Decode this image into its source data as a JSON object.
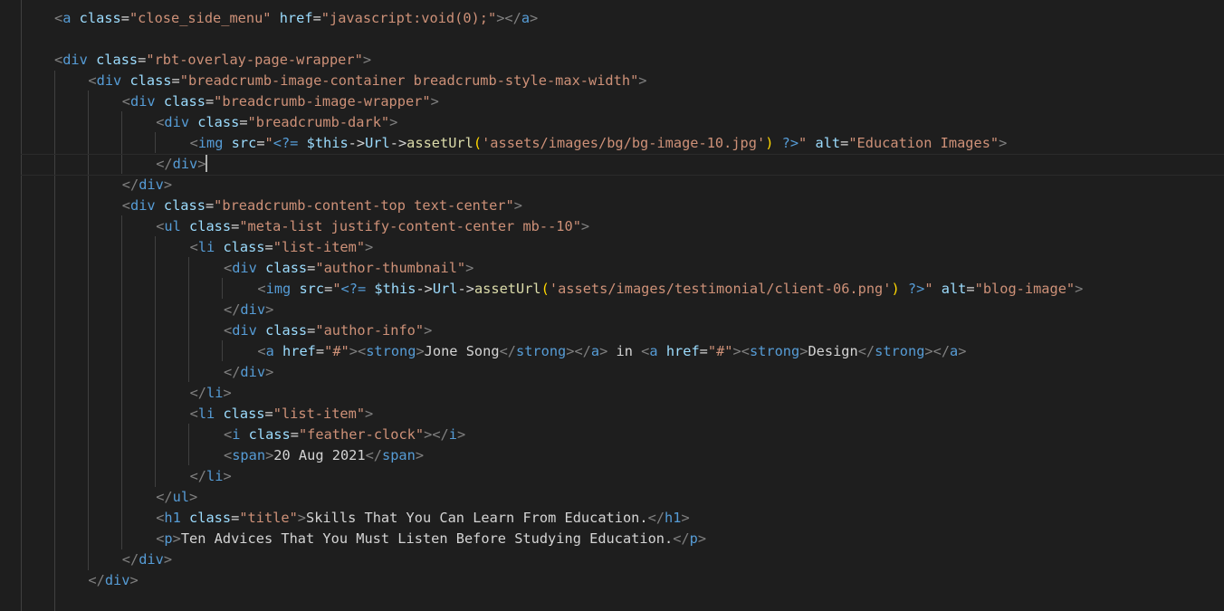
{
  "editor": {
    "language": "html",
    "theme_colors": {
      "background": "#1e1e1e",
      "tag": "#569cd6",
      "punctuation": "#808080",
      "attribute": "#9cdcfe",
      "string": "#ce9178",
      "text": "#d4d4d4",
      "function": "#dcdcaa",
      "brace": "#ffd700"
    },
    "cursor_line": 8,
    "lines": [
      {
        "indent": 0,
        "tokens": [
          [
            "punct",
            "<"
          ],
          [
            "tag",
            "a"
          ],
          [
            "text",
            " "
          ],
          [
            "attr",
            "class"
          ],
          [
            "text",
            "="
          ],
          [
            "str",
            "\"close_side_menu\""
          ],
          [
            "text",
            " "
          ],
          [
            "attr",
            "href"
          ],
          [
            "text",
            "="
          ],
          [
            "str",
            "\"javascript:void(0);\""
          ],
          [
            "punct",
            ">"
          ],
          [
            "punct",
            "</"
          ],
          [
            "tag",
            "a"
          ],
          [
            "punct",
            ">"
          ]
        ]
      },
      {
        "indent": 0,
        "tokens": []
      },
      {
        "indent": 0,
        "tokens": [
          [
            "punct",
            "<"
          ],
          [
            "tag",
            "div"
          ],
          [
            "text",
            " "
          ],
          [
            "attr",
            "class"
          ],
          [
            "text",
            "="
          ],
          [
            "str",
            "\"rbt-overlay-page-wrapper\""
          ],
          [
            "punct",
            ">"
          ]
        ]
      },
      {
        "indent": 1,
        "tokens": [
          [
            "punct",
            "<"
          ],
          [
            "tag",
            "div"
          ],
          [
            "text",
            " "
          ],
          [
            "attr",
            "class"
          ],
          [
            "text",
            "="
          ],
          [
            "str",
            "\"breadcrumb-image-container breadcrumb-style-max-width\""
          ],
          [
            "punct",
            ">"
          ]
        ]
      },
      {
        "indent": 2,
        "tokens": [
          [
            "punct",
            "<"
          ],
          [
            "tag",
            "div"
          ],
          [
            "text",
            " "
          ],
          [
            "attr",
            "class"
          ],
          [
            "text",
            "="
          ],
          [
            "str",
            "\"breadcrumb-image-wrapper\""
          ],
          [
            "punct",
            ">"
          ]
        ]
      },
      {
        "indent": 3,
        "tokens": [
          [
            "punct",
            "<"
          ],
          [
            "tag",
            "div"
          ],
          [
            "text",
            " "
          ],
          [
            "attr",
            "class"
          ],
          [
            "text",
            "="
          ],
          [
            "str",
            "\"breadcrumb-dark\""
          ],
          [
            "punct",
            ">"
          ]
        ]
      },
      {
        "indent": 4,
        "tokens": [
          [
            "punct",
            "<"
          ],
          [
            "tag",
            "img"
          ],
          [
            "text",
            " "
          ],
          [
            "attr",
            "src"
          ],
          [
            "text",
            "="
          ],
          [
            "str",
            "\""
          ],
          [
            "php",
            "<?="
          ],
          [
            "text",
            " "
          ],
          [
            "var",
            "$this"
          ],
          [
            "op",
            "->"
          ],
          [
            "var",
            "Url"
          ],
          [
            "op",
            "->"
          ],
          [
            "func",
            "assetUrl"
          ],
          [
            "brace",
            "("
          ],
          [
            "str",
            "'assets/images/bg/bg-image-10.jpg'"
          ],
          [
            "brace",
            ")"
          ],
          [
            "text",
            " "
          ],
          [
            "php",
            "?>"
          ],
          [
            "str",
            "\""
          ],
          [
            "text",
            " "
          ],
          [
            "attr",
            "alt"
          ],
          [
            "text",
            "="
          ],
          [
            "str",
            "\"Education Images\""
          ],
          [
            "punct",
            ">"
          ]
        ]
      },
      {
        "indent": 3,
        "tokens": [
          [
            "punct",
            "</"
          ],
          [
            "tag",
            "div"
          ],
          [
            "punct",
            ">"
          ]
        ],
        "cursor": true
      },
      {
        "indent": 2,
        "tokens": [
          [
            "punct",
            "</"
          ],
          [
            "tag",
            "div"
          ],
          [
            "punct",
            ">"
          ]
        ]
      },
      {
        "indent": 2,
        "tokens": [
          [
            "punct",
            "<"
          ],
          [
            "tag",
            "div"
          ],
          [
            "text",
            " "
          ],
          [
            "attr",
            "class"
          ],
          [
            "text",
            "="
          ],
          [
            "str",
            "\"breadcrumb-content-top text-center\""
          ],
          [
            "punct",
            ">"
          ]
        ]
      },
      {
        "indent": 3,
        "tokens": [
          [
            "punct",
            "<"
          ],
          [
            "tag",
            "ul"
          ],
          [
            "text",
            " "
          ],
          [
            "attr",
            "class"
          ],
          [
            "text",
            "="
          ],
          [
            "str",
            "\"meta-list justify-content-center mb--10\""
          ],
          [
            "punct",
            ">"
          ]
        ]
      },
      {
        "indent": 4,
        "tokens": [
          [
            "punct",
            "<"
          ],
          [
            "tag",
            "li"
          ],
          [
            "text",
            " "
          ],
          [
            "attr",
            "class"
          ],
          [
            "text",
            "="
          ],
          [
            "str",
            "\"list-item\""
          ],
          [
            "punct",
            ">"
          ]
        ]
      },
      {
        "indent": 5,
        "tokens": [
          [
            "punct",
            "<"
          ],
          [
            "tag",
            "div"
          ],
          [
            "text",
            " "
          ],
          [
            "attr",
            "class"
          ],
          [
            "text",
            "="
          ],
          [
            "str",
            "\"author-thumbnail\""
          ],
          [
            "punct",
            ">"
          ]
        ]
      },
      {
        "indent": 6,
        "tokens": [
          [
            "punct",
            "<"
          ],
          [
            "tag",
            "img"
          ],
          [
            "text",
            " "
          ],
          [
            "attr",
            "src"
          ],
          [
            "text",
            "="
          ],
          [
            "str",
            "\""
          ],
          [
            "php",
            "<?="
          ],
          [
            "text",
            " "
          ],
          [
            "var",
            "$this"
          ],
          [
            "op",
            "->"
          ],
          [
            "var",
            "Url"
          ],
          [
            "op",
            "->"
          ],
          [
            "func",
            "assetUrl"
          ],
          [
            "brace",
            "("
          ],
          [
            "str",
            "'assets/images/testimonial/client-06.png'"
          ],
          [
            "brace",
            ")"
          ],
          [
            "text",
            " "
          ],
          [
            "php",
            "?>"
          ],
          [
            "str",
            "\""
          ],
          [
            "text",
            " "
          ],
          [
            "attr",
            "alt"
          ],
          [
            "text",
            "="
          ],
          [
            "str",
            "\"blog-image\""
          ],
          [
            "punct",
            ">"
          ]
        ]
      },
      {
        "indent": 5,
        "tokens": [
          [
            "punct",
            "</"
          ],
          [
            "tag",
            "div"
          ],
          [
            "punct",
            ">"
          ]
        ]
      },
      {
        "indent": 5,
        "tokens": [
          [
            "punct",
            "<"
          ],
          [
            "tag",
            "div"
          ],
          [
            "text",
            " "
          ],
          [
            "attr",
            "class"
          ],
          [
            "text",
            "="
          ],
          [
            "str",
            "\"author-info\""
          ],
          [
            "punct",
            ">"
          ]
        ]
      },
      {
        "indent": 6,
        "tokens": [
          [
            "punct",
            "<"
          ],
          [
            "tag",
            "a"
          ],
          [
            "text",
            " "
          ],
          [
            "attr",
            "href"
          ],
          [
            "text",
            "="
          ],
          [
            "str",
            "\"#\""
          ],
          [
            "punct",
            ">"
          ],
          [
            "punct",
            "<"
          ],
          [
            "tag",
            "strong"
          ],
          [
            "punct",
            ">"
          ],
          [
            "text",
            "Jone Song"
          ],
          [
            "punct",
            "</"
          ],
          [
            "tag",
            "strong"
          ],
          [
            "punct",
            ">"
          ],
          [
            "punct",
            "</"
          ],
          [
            "tag",
            "a"
          ],
          [
            "punct",
            ">"
          ],
          [
            "text",
            " in "
          ],
          [
            "punct",
            "<"
          ],
          [
            "tag",
            "a"
          ],
          [
            "text",
            " "
          ],
          [
            "attr",
            "href"
          ],
          [
            "text",
            "="
          ],
          [
            "str",
            "\"#\""
          ],
          [
            "punct",
            ">"
          ],
          [
            "punct",
            "<"
          ],
          [
            "tag",
            "strong"
          ],
          [
            "punct",
            ">"
          ],
          [
            "text",
            "Design"
          ],
          [
            "punct",
            "</"
          ],
          [
            "tag",
            "strong"
          ],
          [
            "punct",
            ">"
          ],
          [
            "punct",
            "</"
          ],
          [
            "tag",
            "a"
          ],
          [
            "punct",
            ">"
          ]
        ]
      },
      {
        "indent": 5,
        "tokens": [
          [
            "punct",
            "</"
          ],
          [
            "tag",
            "div"
          ],
          [
            "punct",
            ">"
          ]
        ]
      },
      {
        "indent": 4,
        "tokens": [
          [
            "punct",
            "</"
          ],
          [
            "tag",
            "li"
          ],
          [
            "punct",
            ">"
          ]
        ]
      },
      {
        "indent": 4,
        "tokens": [
          [
            "punct",
            "<"
          ],
          [
            "tag",
            "li"
          ],
          [
            "text",
            " "
          ],
          [
            "attr",
            "class"
          ],
          [
            "text",
            "="
          ],
          [
            "str",
            "\"list-item\""
          ],
          [
            "punct",
            ">"
          ]
        ]
      },
      {
        "indent": 5,
        "tokens": [
          [
            "punct",
            "<"
          ],
          [
            "tag",
            "i"
          ],
          [
            "text",
            " "
          ],
          [
            "attr",
            "class"
          ],
          [
            "text",
            "="
          ],
          [
            "str",
            "\"feather-clock\""
          ],
          [
            "punct",
            ">"
          ],
          [
            "punct",
            "</"
          ],
          [
            "tag",
            "i"
          ],
          [
            "punct",
            ">"
          ]
        ]
      },
      {
        "indent": 5,
        "tokens": [
          [
            "punct",
            "<"
          ],
          [
            "tag",
            "span"
          ],
          [
            "punct",
            ">"
          ],
          [
            "text",
            "20 Aug 2021"
          ],
          [
            "punct",
            "</"
          ],
          [
            "tag",
            "span"
          ],
          [
            "punct",
            ">"
          ]
        ]
      },
      {
        "indent": 4,
        "tokens": [
          [
            "punct",
            "</"
          ],
          [
            "tag",
            "li"
          ],
          [
            "punct",
            ">"
          ]
        ]
      },
      {
        "indent": 3,
        "tokens": [
          [
            "punct",
            "</"
          ],
          [
            "tag",
            "ul"
          ],
          [
            "punct",
            ">"
          ]
        ]
      },
      {
        "indent": 3,
        "tokens": [
          [
            "punct",
            "<"
          ],
          [
            "tag",
            "h1"
          ],
          [
            "text",
            " "
          ],
          [
            "attr",
            "class"
          ],
          [
            "text",
            "="
          ],
          [
            "str",
            "\"title\""
          ],
          [
            "punct",
            ">"
          ],
          [
            "text",
            "Skills That You Can Learn From Education."
          ],
          [
            "punct",
            "</"
          ],
          [
            "tag",
            "h1"
          ],
          [
            "punct",
            ">"
          ]
        ]
      },
      {
        "indent": 3,
        "tokens": [
          [
            "punct",
            "<"
          ],
          [
            "tag",
            "p"
          ],
          [
            "punct",
            ">"
          ],
          [
            "text",
            "Ten Advices That You Must Listen Before Studying Education."
          ],
          [
            "punct",
            "</"
          ],
          [
            "tag",
            "p"
          ],
          [
            "punct",
            ">"
          ]
        ]
      },
      {
        "indent": 2,
        "tokens": [
          [
            "punct",
            "</"
          ],
          [
            "tag",
            "div"
          ],
          [
            "punct",
            ">"
          ]
        ]
      },
      {
        "indent": 1,
        "tokens": [
          [
            "punct",
            "</"
          ],
          [
            "tag",
            "div"
          ],
          [
            "punct",
            ">"
          ]
        ]
      }
    ]
  }
}
